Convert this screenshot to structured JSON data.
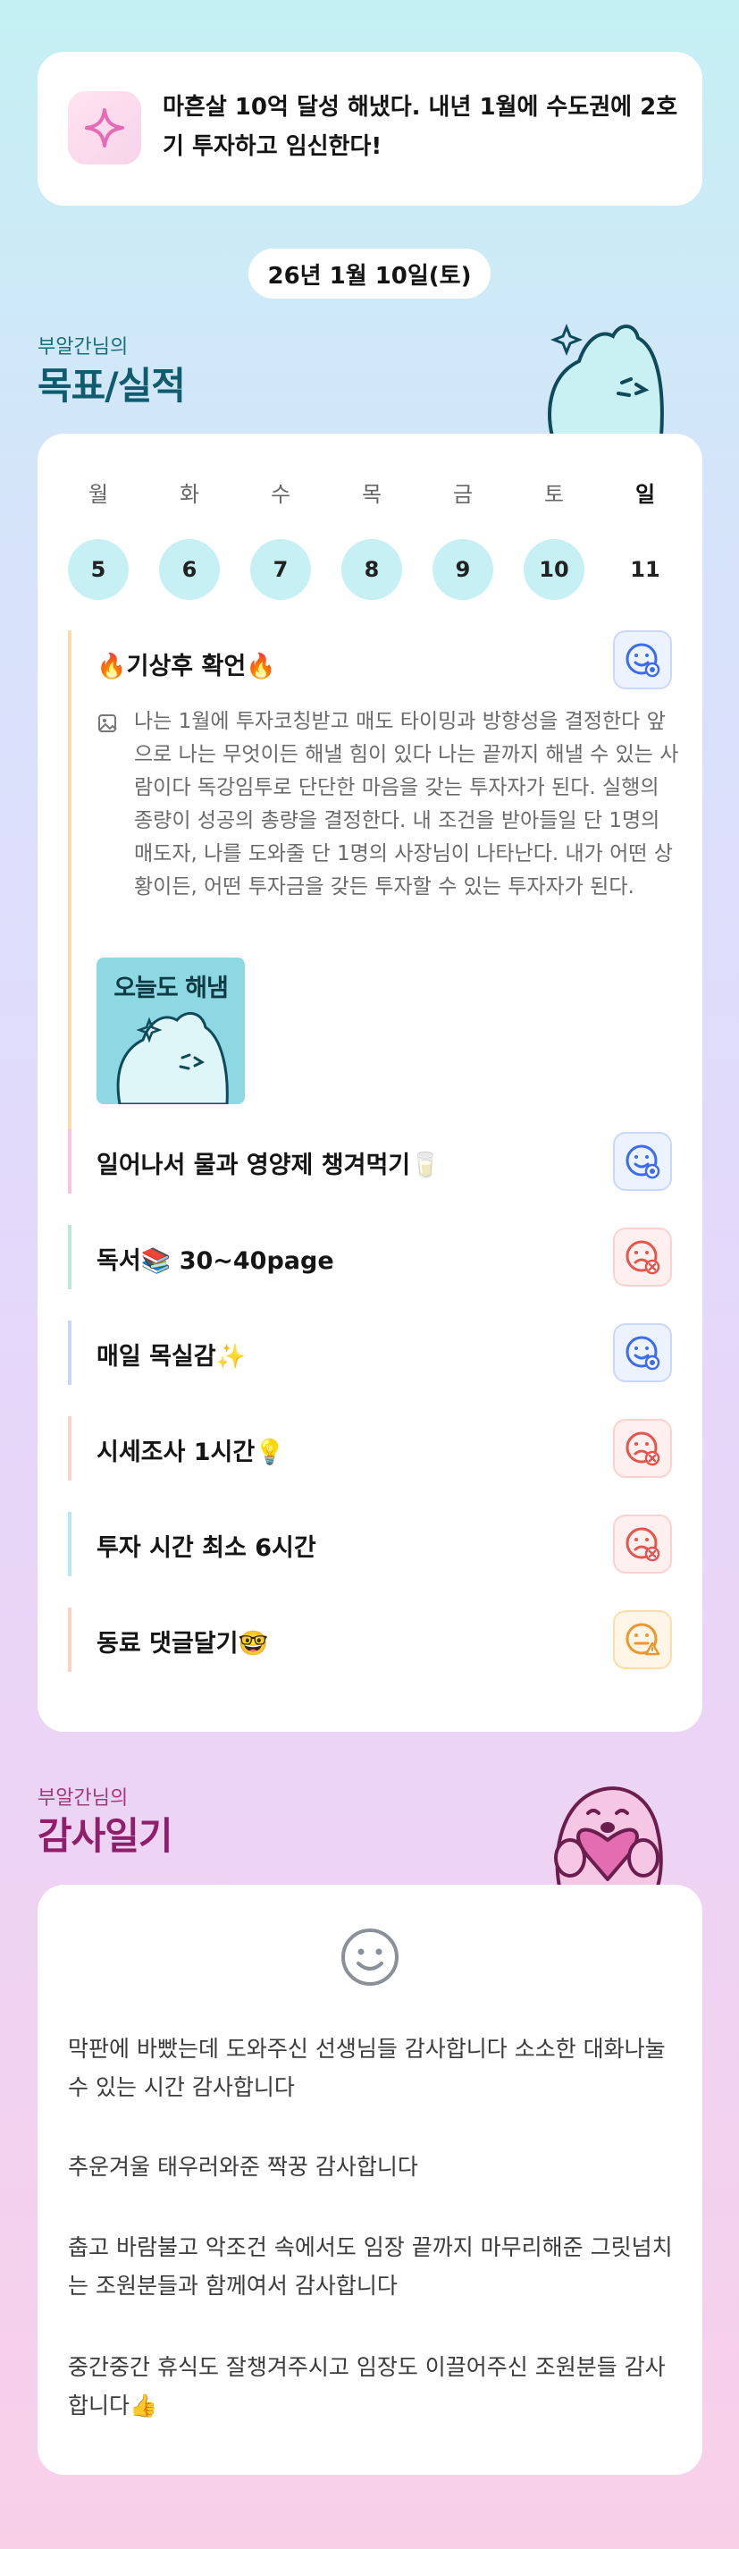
{
  "goal": {
    "icon": "sparkle-icon",
    "text": "마흔살 10억 달성 해냈다. 내년 1월에 수도권에 2호기 투자하고 임신한다!"
  },
  "date": "26년 1월 10일(토)",
  "goals_section": {
    "subtitle": "부알간님의",
    "title": "목표/실적"
  },
  "week": {
    "days": [
      {
        "label": "월",
        "num": "5"
      },
      {
        "label": "화",
        "num": "6"
      },
      {
        "label": "수",
        "num": "7"
      },
      {
        "label": "목",
        "num": "8"
      },
      {
        "label": "금",
        "num": "9"
      },
      {
        "label": "토",
        "num": "10"
      },
      {
        "label": "일",
        "num": "11"
      }
    ]
  },
  "tasks": [
    {
      "title": "🔥기상후 확언🔥",
      "status": "good",
      "color": "#f9dca8",
      "note": "나는 1월에 투자코칭받고 매도 타이밍과 방향성을 결정한다 앞으로 나는 무엇이든 해낼 힘이 있다 나는 끝까지 해낼 수 있는 사람이다 독강임투로 단단한 마음을 갖는 투자자가 된다. 실행의 종량이 성공의 총량을 결정한다. 내 조건을 받아들일 단 1명의 매도자, 나를 도와줄 단 1명의 사장님이 나타난다. 내가 어떤 상황이든, 어떤 투자금을 갖든 투자할 수 있는 투자자가 된다.",
      "sticker_text": "오늘도 해냄"
    },
    {
      "title": "일어나서 물과 영양제 챙겨먹기🥛",
      "status": "good",
      "color": "#f7c6dc"
    },
    {
      "title": "독서📚 30~40page",
      "status": "bad",
      "color": "#b9ead8"
    },
    {
      "title": "매일 목실감✨",
      "status": "good",
      "color": "#cbd6f7"
    },
    {
      "title": "시세조사 1시간💡",
      "status": "bad",
      "color": "#fad2d2"
    },
    {
      "title": "투자 시간 최소 6시간",
      "status": "bad",
      "color": "#b8e6f1"
    },
    {
      "title": "동료 댓글달기🤓",
      "status": "mid",
      "color": "#fbd0c4"
    }
  ],
  "status_colors": {
    "good": "#3b6cf0",
    "bad": "#e8534e",
    "mid": "#f0952c"
  },
  "thanks_section": {
    "subtitle": "부알간님의",
    "title": "감사일기"
  },
  "thanks": {
    "icon": "smiley-icon",
    "paragraphs": [
      "막판에 바빴는데 도와주신 선생님들 감사합니다 소소한 대화나눌수 있는 시간 감사합니다",
      "추운겨울 태우러와준 짝꿍 감사합니다",
      "춥고 바람불고 악조건 속에서도 임장 끝까지 마무리해준 그릿넘치는 조원분들과 함께여서 감사합니다",
      "중간중간 휴식도 잘챙겨주시고 임장도 이끌어주신 조원분들 감사합니다👍"
    ]
  }
}
